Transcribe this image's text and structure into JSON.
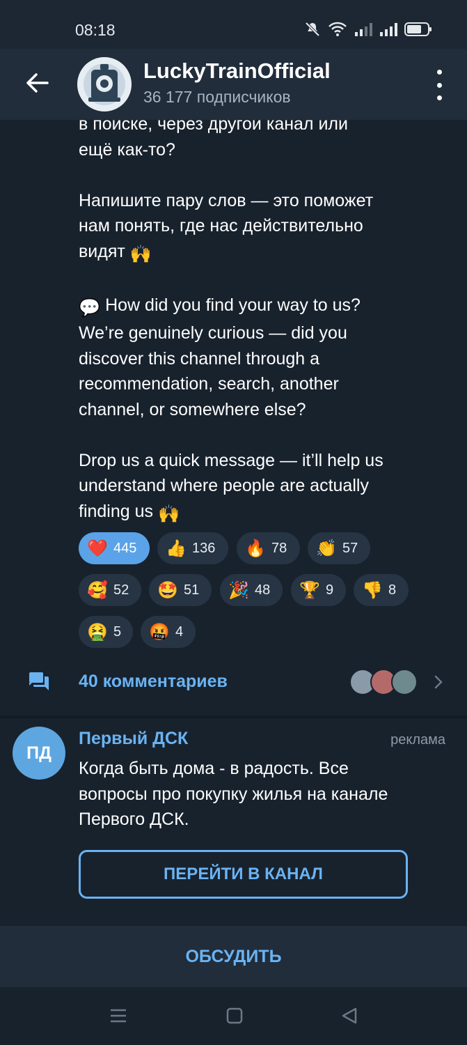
{
  "status_bar": {
    "time": "08:18"
  },
  "header": {
    "back_label": "back",
    "title": "LuckyTrainOfficial",
    "subtitle": "36 177 подписчиков"
  },
  "message": {
    "lines_top": [
      "в поиске, через другой канал или",
      "ещё как-то?"
    ],
    "ru_lines": [
      "Напишите пару слов — это поможет",
      "нам понять, где нас действительно",
      "видят"
    ],
    "en_lines": [
      "How did you find your way to us?",
      "We’re genuinely curious — did you",
      "discover this channel through a",
      "recommendation, search, another",
      "channel, or somewhere else?"
    ],
    "en2_lines": [
      "Drop us a quick message — it’ll help us",
      "understand where people are actually",
      "finding us"
    ]
  },
  "reactions": [
    {
      "icon": "heart-icon",
      "glyph": "❤️",
      "count": "445",
      "active": true
    },
    {
      "icon": "thumbs-up-icon",
      "glyph": "👍",
      "count": "136",
      "active": false
    },
    {
      "icon": "fire-icon",
      "glyph": "🔥",
      "count": "78",
      "active": false
    },
    {
      "icon": "clapping-hands-icon",
      "glyph": "👏",
      "count": "57",
      "active": false
    },
    {
      "icon": "smiling-face-with-hearts-icon",
      "glyph": "🥰",
      "count": "52",
      "active": false
    },
    {
      "icon": "star-struck-icon",
      "glyph": "🤩",
      "count": "51",
      "active": false
    },
    {
      "icon": "party-popper-icon",
      "glyph": "🎉",
      "count": "48",
      "active": false
    },
    {
      "icon": "trophy-icon",
      "glyph": "🏆",
      "count": "9",
      "active": false
    },
    {
      "icon": "thumbs-down-icon",
      "glyph": "👎",
      "count": "8",
      "active": false
    },
    {
      "icon": "vomiting-face-icon",
      "glyph": "🤮",
      "count": "5",
      "active": false
    },
    {
      "icon": "cursing-face-icon",
      "glyph": "🤬",
      "count": "4",
      "active": false
    }
  ],
  "comments": {
    "label": "40 комментариев"
  },
  "ad": {
    "avatar_initials": "ПД",
    "name": "Первый ДСК",
    "tag": "реклама",
    "text": "Когда быть дома - в радость. Все вопросы про покупку жилья на канале Первого ДСК.",
    "button_label": "ПЕРЕЙТИ В КАНАЛ"
  },
  "discuss": {
    "label": "ОБСУДИТЬ"
  },
  "colors": {
    "background": "#18222d",
    "header": "#212d3b",
    "accent": "#6ab3f3",
    "reaction_active": "#5aa3e8",
    "reaction_bg": "#263444"
  }
}
